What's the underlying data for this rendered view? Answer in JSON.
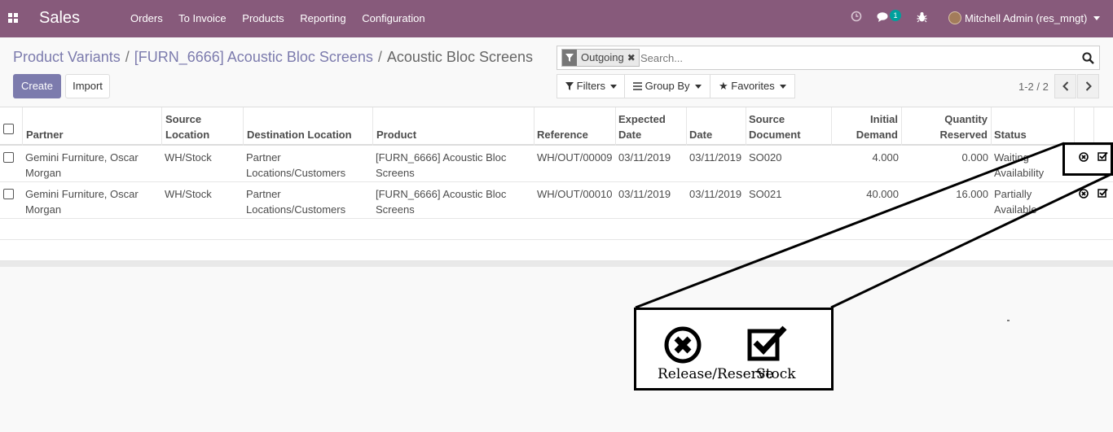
{
  "navbar": {
    "app_name": "Sales",
    "menu": [
      "Orders",
      "To Invoice",
      "Products",
      "Reporting",
      "Configuration"
    ],
    "messages_count": "1",
    "user": "Mitchell Admin (res_mngt)",
    "icons": [
      "apps-grid-icon",
      "clock-icon",
      "chat-icon",
      "bug-icon"
    ]
  },
  "breadcrumb": {
    "items": [
      "Product Variants",
      "[FURN_6666] Acoustic Bloc Screens"
    ],
    "current": "Acoustic Bloc Screens"
  },
  "buttons": {
    "create": "Create",
    "import": "Import"
  },
  "search": {
    "facet": "Outgoing",
    "placeholder": "Search..."
  },
  "filters": {
    "filters": "Filters",
    "group_by": "Group By",
    "favorites": "Favorites"
  },
  "pager": {
    "text": "1-2 / 2"
  },
  "table": {
    "headers": {
      "partner": "Partner",
      "source_location": [
        "Source",
        "Location"
      ],
      "destination_location": "Destination Location",
      "product": "Product",
      "reference": "Reference",
      "expected_date": [
        "Expected",
        "Date"
      ],
      "date": "Date",
      "source_document": [
        "Source",
        "Document"
      ],
      "initial_demand": [
        "Initial",
        "Demand"
      ],
      "quantity_reserved": [
        "Quantity",
        "Reserved"
      ],
      "status": "Status"
    },
    "rows": [
      {
        "partner": [
          "Gemini Furniture, Oscar",
          "Morgan"
        ],
        "source_location": "WH/Stock",
        "destination_location": [
          "Partner",
          "Locations/Customers"
        ],
        "product": [
          "[FURN_6666] Acoustic Bloc",
          "Screens"
        ],
        "reference": "WH/OUT/00009",
        "expected_date": "03/11/2019",
        "date": "03/11/2019",
        "source_document": "SO020",
        "initial_demand": "4.000",
        "quantity_reserved": "0.000",
        "status": [
          "Waiting",
          "Availability"
        ]
      },
      {
        "partner": [
          "Gemini Furniture, Oscar",
          "Morgan"
        ],
        "source_location": "WH/Stock",
        "destination_location": [
          "Partner",
          "Locations/Customers"
        ],
        "product": [
          "[FURN_6666] Acoustic Bloc",
          "Screens"
        ],
        "reference": "WH/OUT/00010",
        "expected_date": "03/11/2019",
        "date": "03/11/2019",
        "source_document": "SO021",
        "initial_demand": "40.000",
        "quantity_reserved": "16.000",
        "status": [
          "Partially",
          "Available"
        ]
      }
    ]
  },
  "legend": {
    "release_label": "Release/Reserve",
    "stock_label": "Stock"
  }
}
